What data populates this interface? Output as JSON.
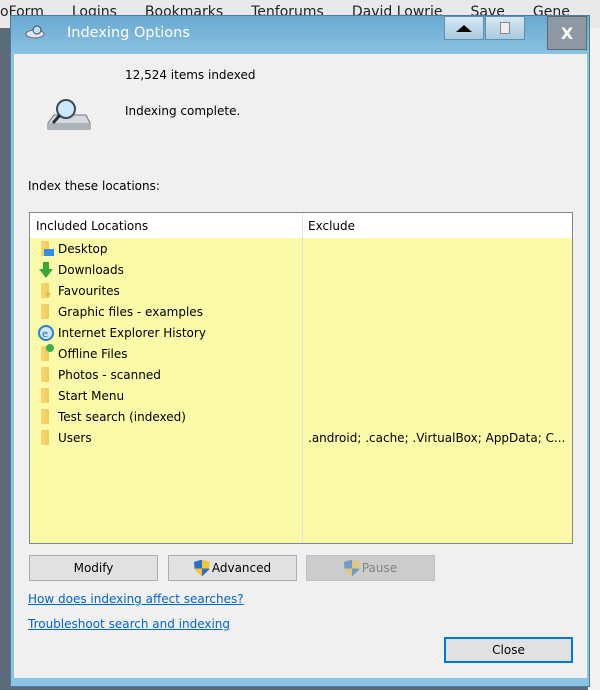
{
  "background": {
    "bookmarks": [
      "oForm",
      "Logins",
      "Bookmarks",
      "Tenforums",
      "David Lowrie",
      "Save",
      "Gene"
    ]
  },
  "window": {
    "title": "Indexing Options",
    "close_label": "X"
  },
  "status": {
    "items_indexed": "12,524 items indexed",
    "state": "Indexing complete."
  },
  "locations_label": "Index these locations:",
  "list": {
    "headers": [
      "Included Locations",
      "Exclude"
    ],
    "rows": [
      {
        "name": "Desktop",
        "exclude": "",
        "icon": "desktop-folder-icon"
      },
      {
        "name": "Downloads",
        "exclude": "",
        "icon": "downloads-icon"
      },
      {
        "name": "Favourites",
        "exclude": "",
        "icon": "favourites-folder-icon"
      },
      {
        "name": "Graphic files - examples",
        "exclude": "",
        "icon": "folder-icon"
      },
      {
        "name": "Internet Explorer History",
        "exclude": "",
        "icon": "ie-history-icon"
      },
      {
        "name": "Offline Files",
        "exclude": "",
        "icon": "offline-files-icon"
      },
      {
        "name": "Photos - scanned",
        "exclude": "",
        "icon": "folder-icon"
      },
      {
        "name": "Start Menu",
        "exclude": "",
        "icon": "folder-icon"
      },
      {
        "name": "Test search (indexed)",
        "exclude": "",
        "icon": "folder-icon"
      },
      {
        "name": "Users",
        "exclude": ".android; .cache; .VirtualBox; AppData; C...",
        "icon": "folder-icon"
      }
    ]
  },
  "buttons": {
    "modify": "Modify",
    "advanced": "Advanced",
    "pause": "Pause",
    "close": "Close"
  },
  "links": {
    "help": "How does indexing affect searches?",
    "troubleshoot": "Troubleshoot search and indexing"
  },
  "colors": {
    "list_bg": "#fafaa8",
    "link": "#0066cc",
    "frame": "#8cc3e3"
  }
}
